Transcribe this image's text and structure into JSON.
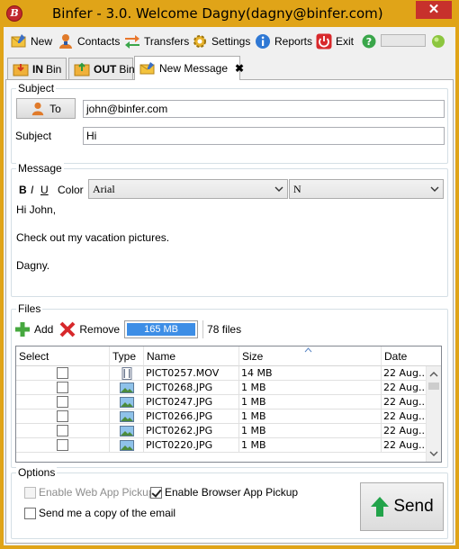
{
  "window": {
    "title": "Binfer - 3.0. Welcome Dagny(dagny@binfer.com)",
    "logo_letter": "B",
    "close_glyph": "✕"
  },
  "toolbar": {
    "new": "New",
    "contacts": "Contacts",
    "transfers": "Transfers",
    "settings": "Settings",
    "reports": "Reports",
    "exit": "Exit"
  },
  "tabs": [
    {
      "bold": "IN",
      "label": "Bin"
    },
    {
      "bold": "OUT",
      "label": "Bin"
    },
    {
      "label": "New Message",
      "close": "✖"
    }
  ],
  "subject_group": {
    "label": "Subject",
    "to_button": "To",
    "to_value": "john@binfer.com",
    "subject_label": "Subject",
    "subject_value": "Hi"
  },
  "message_group": {
    "label": "Message",
    "bold": "B",
    "italic": "I",
    "underline": "U",
    "color": "Color",
    "font": "Arial",
    "size": "N",
    "lines": [
      "Hi John,",
      "Check out my vacation pictures.",
      "Dagny."
    ]
  },
  "files_group": {
    "label": "Files",
    "add": "Add",
    "remove": "Remove",
    "total_size": "165 MB",
    "file_count": "78 files",
    "columns": [
      "Select",
      "Type",
      "Name",
      "Size",
      "Date"
    ],
    "rows": [
      {
        "type": "movie",
        "name": "PICT0257.MOV",
        "size": "14 MB",
        "date": "22 Aug..."
      },
      {
        "type": "image",
        "name": "PICT0268.JPG",
        "size": "1 MB",
        "date": "22 Aug..."
      },
      {
        "type": "image",
        "name": "PICT0247.JPG",
        "size": "1 MB",
        "date": "22 Aug..."
      },
      {
        "type": "image",
        "name": "PICT0266.JPG",
        "size": "1 MB",
        "date": "22 Aug..."
      },
      {
        "type": "image",
        "name": "PICT0262.JPG",
        "size": "1 MB",
        "date": "22 Aug..."
      },
      {
        "type": "image",
        "name": "PICT0220.JPG",
        "size": "1 MB",
        "date": "22 Aug..."
      }
    ]
  },
  "options_group": {
    "label": "Options",
    "web_app_pickup": "Enable Web App Pickup",
    "web_app_pickup_checked": false,
    "browser_app_pickup": "Enable Browser App Pickup",
    "browser_app_pickup_checked": true,
    "send_copy": "Send me a copy of the email",
    "send_copy_checked": false,
    "send": "Send"
  },
  "colors": {
    "titlebar": "#e0a418",
    "close": "#c7312c",
    "send_arrow": "#22a34a",
    "size_bar": "#3d8ee6"
  }
}
